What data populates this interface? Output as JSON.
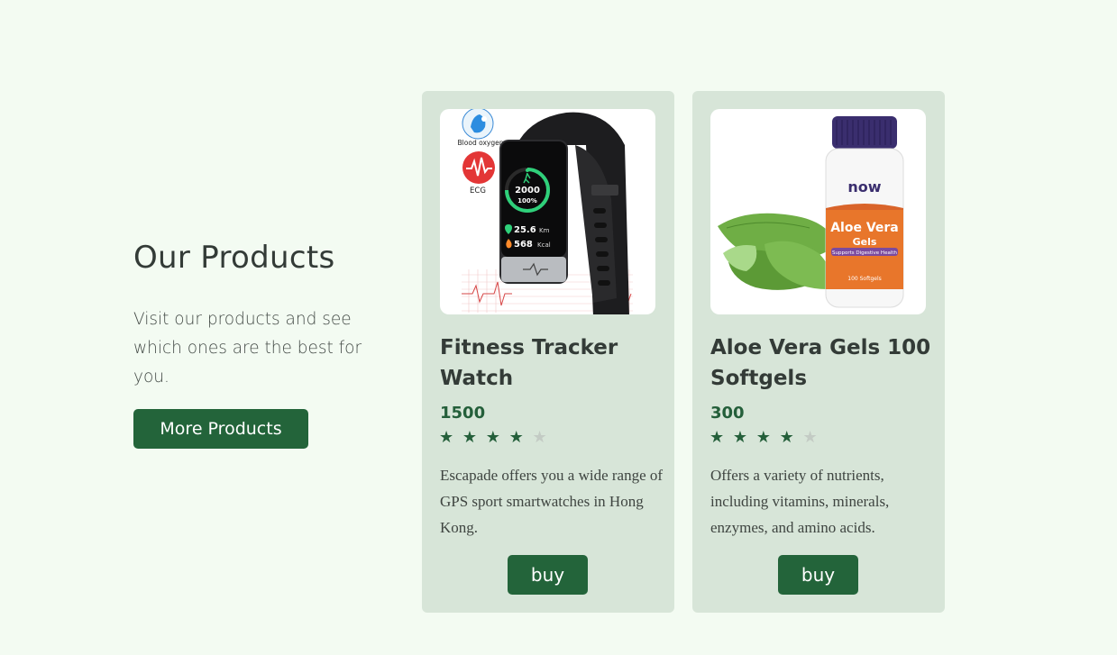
{
  "section": {
    "title": "Our Products",
    "description": "Visit our products and see which ones are the best for you.",
    "more_button": "More Products"
  },
  "products": [
    {
      "name": "Fitness Tracker Watch",
      "price": "1500",
      "rating": 4,
      "rating_max": 5,
      "description": "Escapade offers you a wide range of GPS sport smartwatches in Hong Kong.",
      "buy_label": "buy",
      "image": {
        "badge_blood": "Blood oxygen",
        "badge_ecg": "ECG",
        "steps": "2000",
        "percent": "100%",
        "distance": "25.6",
        "distance_unit": "Km",
        "calories": "568",
        "calories_unit": "Kcal"
      }
    },
    {
      "name": "Aloe Vera Gels 100 Softgels",
      "price": "300",
      "rating": 4,
      "rating_max": 5,
      "description": "Offers a variety of nutrients, including vitamins, minerals, enzymes, and amino acids.",
      "buy_label": "buy",
      "image": {
        "brand": "now",
        "label_line1": "Aloe Vera",
        "label_line2": "Gels",
        "label_tag": "Supports Digestive Health",
        "count": "100 Softgels"
      }
    }
  ],
  "colors": {
    "background": "#f3fbf2",
    "card": "#d7e5d8",
    "accent": "#23643a",
    "text": "#333b37"
  },
  "icons": {
    "star": "star-icon",
    "heart": "heart-pulse-icon",
    "pin": "location-pin-icon",
    "flame": "flame-icon",
    "walk": "walking-person-icon"
  }
}
